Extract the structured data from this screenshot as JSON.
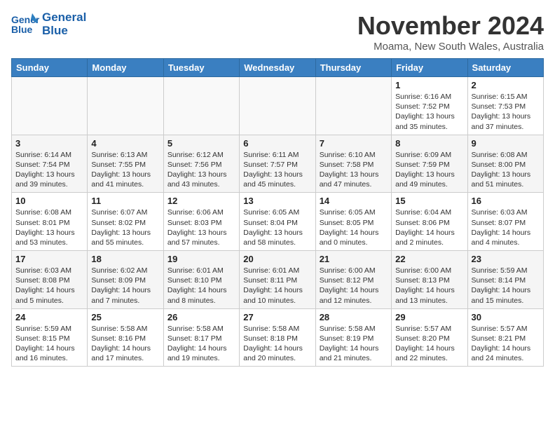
{
  "header": {
    "logo_line1": "General",
    "logo_line2": "Blue",
    "month_title": "November 2024",
    "location": "Moama, New South Wales, Australia"
  },
  "days_of_week": [
    "Sunday",
    "Monday",
    "Tuesday",
    "Wednesday",
    "Thursday",
    "Friday",
    "Saturday"
  ],
  "weeks": [
    [
      {
        "day": "",
        "text": ""
      },
      {
        "day": "",
        "text": ""
      },
      {
        "day": "",
        "text": ""
      },
      {
        "day": "",
        "text": ""
      },
      {
        "day": "",
        "text": ""
      },
      {
        "day": "1",
        "text": "Sunrise: 6:16 AM\nSunset: 7:52 PM\nDaylight: 13 hours\nand 35 minutes."
      },
      {
        "day": "2",
        "text": "Sunrise: 6:15 AM\nSunset: 7:53 PM\nDaylight: 13 hours\nand 37 minutes."
      }
    ],
    [
      {
        "day": "3",
        "text": "Sunrise: 6:14 AM\nSunset: 7:54 PM\nDaylight: 13 hours\nand 39 minutes."
      },
      {
        "day": "4",
        "text": "Sunrise: 6:13 AM\nSunset: 7:55 PM\nDaylight: 13 hours\nand 41 minutes."
      },
      {
        "day": "5",
        "text": "Sunrise: 6:12 AM\nSunset: 7:56 PM\nDaylight: 13 hours\nand 43 minutes."
      },
      {
        "day": "6",
        "text": "Sunrise: 6:11 AM\nSunset: 7:57 PM\nDaylight: 13 hours\nand 45 minutes."
      },
      {
        "day": "7",
        "text": "Sunrise: 6:10 AM\nSunset: 7:58 PM\nDaylight: 13 hours\nand 47 minutes."
      },
      {
        "day": "8",
        "text": "Sunrise: 6:09 AM\nSunset: 7:59 PM\nDaylight: 13 hours\nand 49 minutes."
      },
      {
        "day": "9",
        "text": "Sunrise: 6:08 AM\nSunset: 8:00 PM\nDaylight: 13 hours\nand 51 minutes."
      }
    ],
    [
      {
        "day": "10",
        "text": "Sunrise: 6:08 AM\nSunset: 8:01 PM\nDaylight: 13 hours\nand 53 minutes."
      },
      {
        "day": "11",
        "text": "Sunrise: 6:07 AM\nSunset: 8:02 PM\nDaylight: 13 hours\nand 55 minutes."
      },
      {
        "day": "12",
        "text": "Sunrise: 6:06 AM\nSunset: 8:03 PM\nDaylight: 13 hours\nand 57 minutes."
      },
      {
        "day": "13",
        "text": "Sunrise: 6:05 AM\nSunset: 8:04 PM\nDaylight: 13 hours\nand 58 minutes."
      },
      {
        "day": "14",
        "text": "Sunrise: 6:05 AM\nSunset: 8:05 PM\nDaylight: 14 hours\nand 0 minutes."
      },
      {
        "day": "15",
        "text": "Sunrise: 6:04 AM\nSunset: 8:06 PM\nDaylight: 14 hours\nand 2 minutes."
      },
      {
        "day": "16",
        "text": "Sunrise: 6:03 AM\nSunset: 8:07 PM\nDaylight: 14 hours\nand 4 minutes."
      }
    ],
    [
      {
        "day": "17",
        "text": "Sunrise: 6:03 AM\nSunset: 8:08 PM\nDaylight: 14 hours\nand 5 minutes."
      },
      {
        "day": "18",
        "text": "Sunrise: 6:02 AM\nSunset: 8:09 PM\nDaylight: 14 hours\nand 7 minutes."
      },
      {
        "day": "19",
        "text": "Sunrise: 6:01 AM\nSunset: 8:10 PM\nDaylight: 14 hours\nand 8 minutes."
      },
      {
        "day": "20",
        "text": "Sunrise: 6:01 AM\nSunset: 8:11 PM\nDaylight: 14 hours\nand 10 minutes."
      },
      {
        "day": "21",
        "text": "Sunrise: 6:00 AM\nSunset: 8:12 PM\nDaylight: 14 hours\nand 12 minutes."
      },
      {
        "day": "22",
        "text": "Sunrise: 6:00 AM\nSunset: 8:13 PM\nDaylight: 14 hours\nand 13 minutes."
      },
      {
        "day": "23",
        "text": "Sunrise: 5:59 AM\nSunset: 8:14 PM\nDaylight: 14 hours\nand 15 minutes."
      }
    ],
    [
      {
        "day": "24",
        "text": "Sunrise: 5:59 AM\nSunset: 8:15 PM\nDaylight: 14 hours\nand 16 minutes."
      },
      {
        "day": "25",
        "text": "Sunrise: 5:58 AM\nSunset: 8:16 PM\nDaylight: 14 hours\nand 17 minutes."
      },
      {
        "day": "26",
        "text": "Sunrise: 5:58 AM\nSunset: 8:17 PM\nDaylight: 14 hours\nand 19 minutes."
      },
      {
        "day": "27",
        "text": "Sunrise: 5:58 AM\nSunset: 8:18 PM\nDaylight: 14 hours\nand 20 minutes."
      },
      {
        "day": "28",
        "text": "Sunrise: 5:58 AM\nSunset: 8:19 PM\nDaylight: 14 hours\nand 21 minutes."
      },
      {
        "day": "29",
        "text": "Sunrise: 5:57 AM\nSunset: 8:20 PM\nDaylight: 14 hours\nand 22 minutes."
      },
      {
        "day": "30",
        "text": "Sunrise: 5:57 AM\nSunset: 8:21 PM\nDaylight: 14 hours\nand 24 minutes."
      }
    ]
  ]
}
